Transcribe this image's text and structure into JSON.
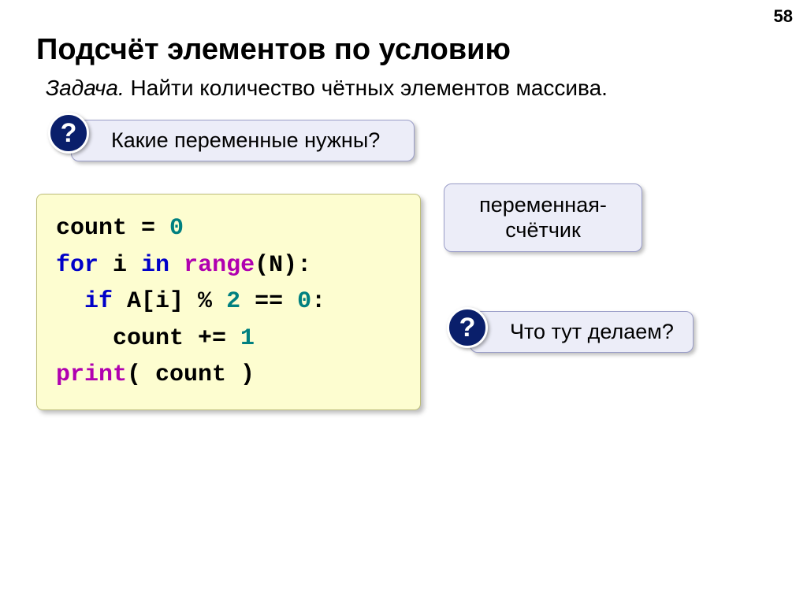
{
  "page_number": "58",
  "title": "Подсчёт элементов по условию",
  "task": {
    "label": "Задача.",
    "text": " Найти количество чётных элементов массива."
  },
  "callouts": {
    "q1": {
      "badge": "?",
      "text": "Какие переменные нужны?"
    },
    "counter": {
      "line1": "переменная-",
      "line2": "счётчик"
    },
    "q2": {
      "badge": "?",
      "text": "Что тут делаем?"
    }
  },
  "code": {
    "t1": "count = ",
    "zero": "0",
    "t2": "for",
    "t3": " i ",
    "t4": "in",
    "t5": " ",
    "t6": "range",
    "t7": "(N):",
    "t8": "  ",
    "t9": "if",
    "t10": " A[i] % ",
    "two": "2",
    "t11": " == ",
    "zero2": "0",
    "t12": ":",
    "t13": "    count += ",
    "one": "1",
    "t14": "print",
    "t15": "( count )"
  }
}
